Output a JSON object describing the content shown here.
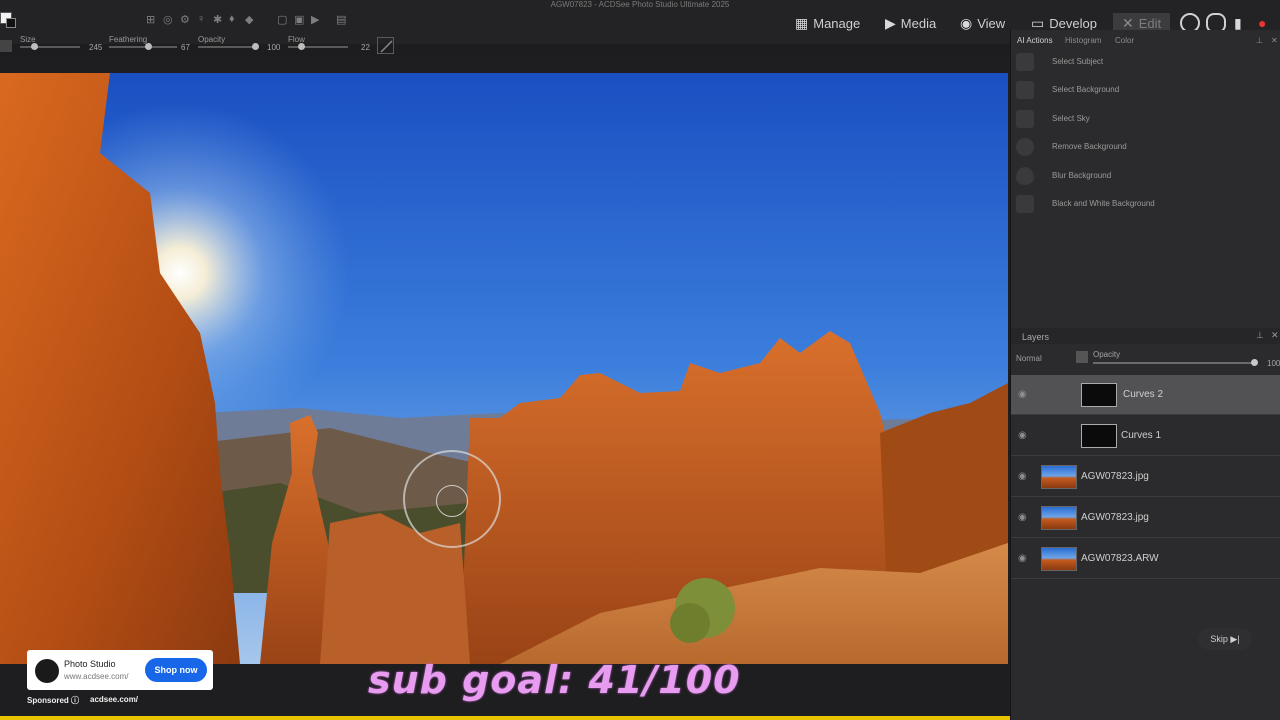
{
  "window": {
    "title": "AGW07823 - ACDSee Photo Studio Ultimate 2025"
  },
  "modes": {
    "manage": "Manage",
    "media": "Media",
    "view": "View",
    "develop": "Develop",
    "edit": "Edit"
  },
  "brush_options": {
    "size_label": "Size",
    "size_value": "245",
    "feathering_label": "Feathering",
    "feathering_value": "67",
    "opacity_label": "Opacity",
    "opacity_value": "100",
    "flow_label": "Flow",
    "flow_value": "22",
    "levels": {
      "size": 0.2,
      "feathering": 0.67,
      "opacity": 1.0,
      "flow": 0.22
    }
  },
  "right_panel": {
    "tabs": [
      "AI Actions",
      "Histogram",
      "Color"
    ],
    "ai_actions": [
      {
        "label": "Select Subject",
        "icon": "person-icon"
      },
      {
        "label": "Select Background",
        "icon": "background-icon"
      },
      {
        "label": "Select Sky",
        "icon": "sky-icon"
      },
      {
        "label": "Remove Background",
        "icon": "remove-bg-icon"
      },
      {
        "label": "Blur Background",
        "icon": "blur-drop-icon"
      },
      {
        "label": "Black and White Background",
        "icon": "bw-icon"
      }
    ],
    "layers": {
      "title": "Layers",
      "blend_mode": "Normal",
      "opacity_label": "Opacity",
      "opacity_value": "100",
      "items": [
        {
          "name": "Curves 2",
          "type": "mask",
          "selected": true
        },
        {
          "name": "Curves 1",
          "type": "mask",
          "selected": false
        },
        {
          "name": "AGW07823.jpg",
          "type": "photo",
          "selected": false
        },
        {
          "name": "AGW07823.jpg",
          "type": "photo",
          "selected": false
        },
        {
          "name": "AGW07823.ARW",
          "type": "photo",
          "selected": false
        }
      ]
    }
  },
  "skip_button": {
    "label": "Skip ▶|"
  },
  "ad": {
    "title": "Photo Studio",
    "url": "www.acdsee.com/",
    "button": "Shop now",
    "sponsored": "Sponsored ⓘ",
    "footer_url": "acdsee.com/"
  },
  "overlay_text": "sub goal: 41/100",
  "colors": {
    "accent": "#1867e8",
    "overlay": "#e79cf0",
    "panel": "#2b2b2d"
  }
}
